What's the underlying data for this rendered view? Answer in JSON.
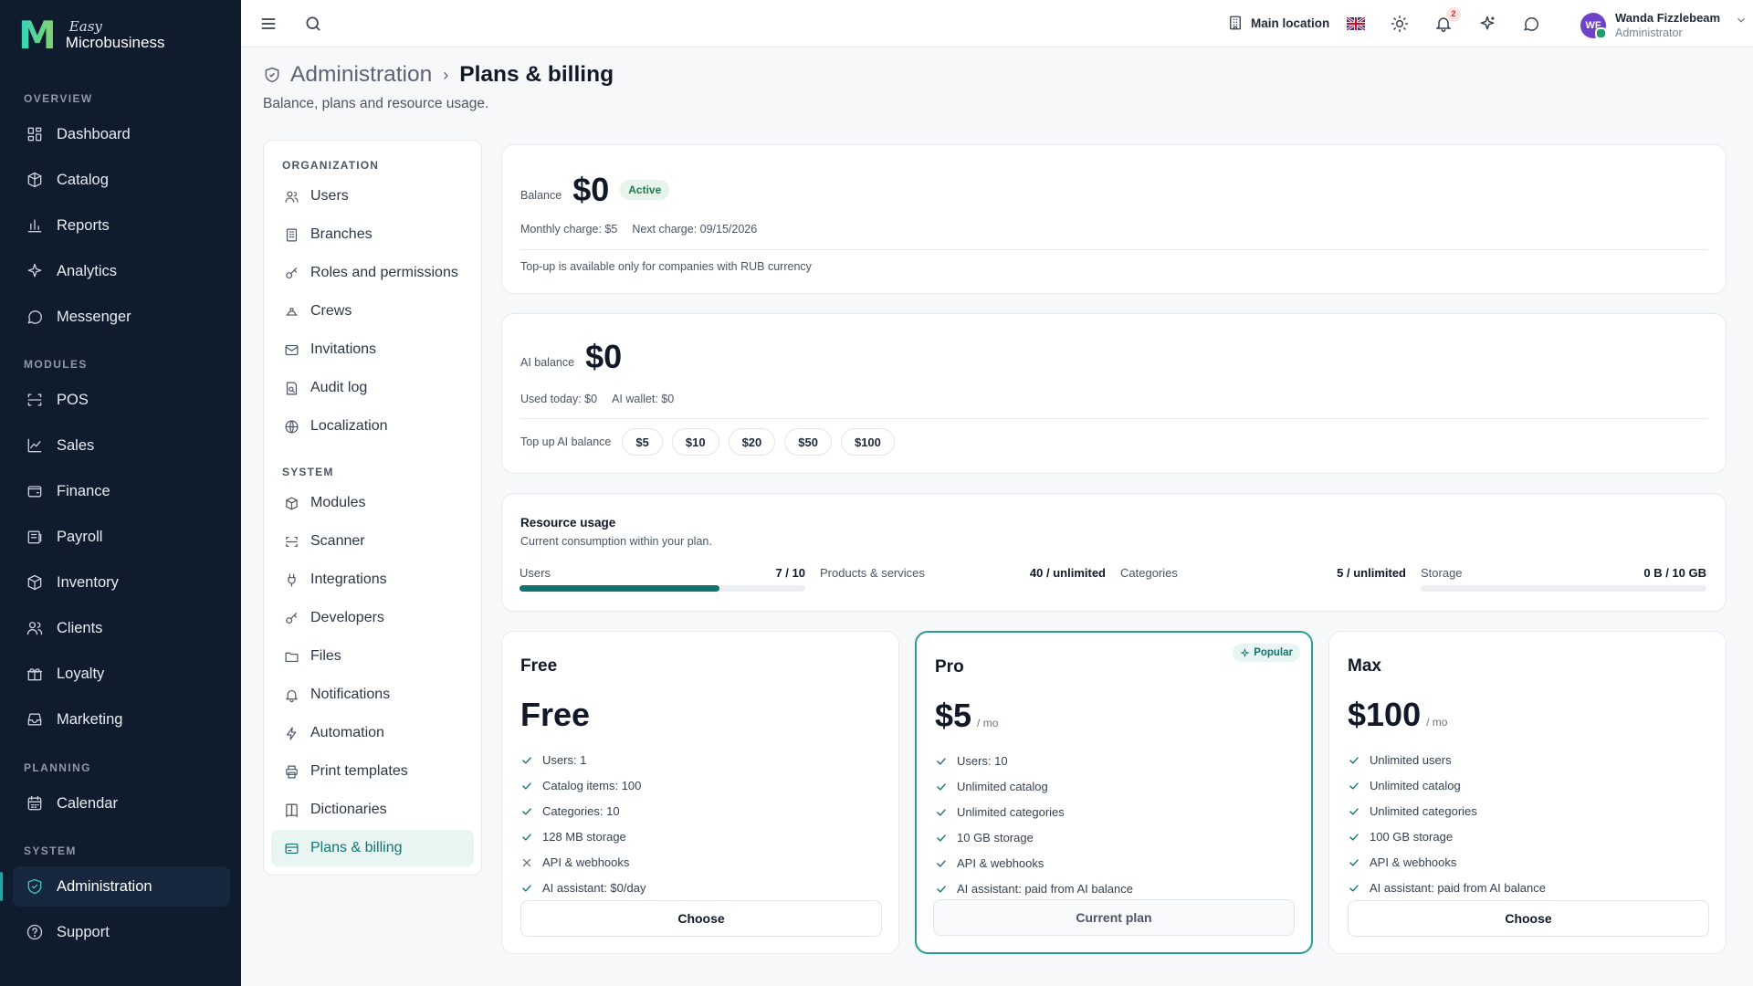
{
  "brand": {
    "mark": "M",
    "line1": "Easy",
    "line2": "Microbusiness"
  },
  "sidebar": {
    "sections": [
      {
        "label": "OVERVIEW",
        "items": [
          {
            "label": "Dashboard",
            "icon": "dashboard-icon"
          },
          {
            "label": "Catalog",
            "icon": "catalog-icon"
          },
          {
            "label": "Reports",
            "icon": "reports-icon"
          },
          {
            "label": "Analytics",
            "icon": "sparkle-icon"
          },
          {
            "label": "Messenger",
            "icon": "chat-icon"
          }
        ]
      },
      {
        "label": "MODULES",
        "items": [
          {
            "label": "POS",
            "icon": "scan-icon"
          },
          {
            "label": "Sales",
            "icon": "line-chart-icon"
          },
          {
            "label": "Finance",
            "icon": "wallet-icon"
          },
          {
            "label": "Payroll",
            "icon": "payroll-icon"
          },
          {
            "label": "Inventory",
            "icon": "box-icon"
          },
          {
            "label": "Clients",
            "icon": "users-icon"
          },
          {
            "label": "Loyalty",
            "icon": "gift-icon"
          },
          {
            "label": "Marketing",
            "icon": "inbox-icon"
          }
        ]
      },
      {
        "label": "PLANNING",
        "items": [
          {
            "label": "Calendar",
            "icon": "calendar-icon"
          }
        ]
      },
      {
        "label": "SYSTEM",
        "items": [
          {
            "label": "Administration",
            "icon": "shield-icon",
            "active": true
          },
          {
            "label": "Support",
            "icon": "help-icon"
          }
        ]
      }
    ]
  },
  "topbar": {
    "location": "Main location",
    "notifications_count": "2",
    "user": {
      "initials": "WF",
      "name": "Wanda Fizzlebeam",
      "role": "Administrator"
    }
  },
  "page": {
    "breadcrumb_parent": "Administration",
    "breadcrumb_sep": "›",
    "title": "Plans & billing",
    "subtitle": "Balance, plans and resource usage."
  },
  "subnav": {
    "sections": [
      {
        "label": "ORGANIZATION",
        "items": [
          {
            "label": "Users",
            "icon": "users-icon"
          },
          {
            "label": "Branches",
            "icon": "building-icon"
          },
          {
            "label": "Roles and permissions",
            "icon": "key-icon"
          },
          {
            "label": "Crews",
            "icon": "crew-icon"
          },
          {
            "label": "Invitations",
            "icon": "mail-icon"
          },
          {
            "label": "Audit log",
            "icon": "audit-icon"
          },
          {
            "label": "Localization",
            "icon": "globe-icon"
          }
        ]
      },
      {
        "label": "SYSTEM",
        "items": [
          {
            "label": "Modules",
            "icon": "box-icon"
          },
          {
            "label": "Scanner",
            "icon": "scan-icon"
          },
          {
            "label": "Integrations",
            "icon": "plug-icon"
          },
          {
            "label": "Developers",
            "icon": "key-icon"
          },
          {
            "label": "Files",
            "icon": "folder-icon"
          },
          {
            "label": "Notifications",
            "icon": "bell-icon"
          },
          {
            "label": "Automation",
            "icon": "bolt-icon"
          },
          {
            "label": "Print templates",
            "icon": "printer-icon"
          },
          {
            "label": "Dictionaries",
            "icon": "book-icon"
          },
          {
            "label": "Plans & billing",
            "icon": "card-icon",
            "active": true
          }
        ]
      }
    ]
  },
  "balance": {
    "label": "Balance",
    "amount": "$0",
    "status": "Active",
    "monthly_charge": "Monthly charge: $5",
    "next_charge": "Next charge: 09/15/2026",
    "note": "Top-up is available only for companies with RUB currency"
  },
  "ai_balance": {
    "label": "AI balance",
    "amount": "$0",
    "used_today": "Used today: $0",
    "wallet": "AI wallet: $0",
    "topup_label": "Top up AI balance",
    "topup_options": [
      "$5",
      "$10",
      "$20",
      "$50",
      "$100"
    ]
  },
  "resources": {
    "title": "Resource usage",
    "subtitle": "Current consumption within your plan.",
    "items": [
      {
        "label": "Users",
        "value": "7 / 10",
        "fraction": 0.7,
        "bar": true
      },
      {
        "label": "Products & services",
        "value": "40 / unlimited",
        "bar": false
      },
      {
        "label": "Categories",
        "value": "5 / unlimited",
        "bar": false
      },
      {
        "label": "Storage",
        "value": "0 B / 10 GB",
        "fraction": 0,
        "bar": true
      }
    ]
  },
  "plans": [
    {
      "name": "Free",
      "price": "Free",
      "unit": "",
      "popular": false,
      "button": "Choose",
      "current": false,
      "features": [
        {
          "t": "Users: 1",
          "ok": true
        },
        {
          "t": "Catalog items: 100",
          "ok": true
        },
        {
          "t": "Categories: 10",
          "ok": true
        },
        {
          "t": "128 MB storage",
          "ok": true
        },
        {
          "t": "API & webhooks",
          "ok": false
        },
        {
          "t": "AI assistant: $0/day",
          "ok": true
        }
      ]
    },
    {
      "name": "Pro",
      "price": "$5",
      "unit": "/ mo",
      "popular": true,
      "popular_label": "Popular",
      "button": "Current plan",
      "current": true,
      "features": [
        {
          "t": "Users: 10",
          "ok": true
        },
        {
          "t": "Unlimited catalog",
          "ok": true
        },
        {
          "t": "Unlimited categories",
          "ok": true
        },
        {
          "t": "10 GB storage",
          "ok": true
        },
        {
          "t": "API & webhooks",
          "ok": true
        },
        {
          "t": "AI assistant: paid from AI balance",
          "ok": true
        }
      ]
    },
    {
      "name": "Max",
      "price": "$100",
      "unit": "/ mo",
      "popular": false,
      "button": "Choose",
      "current": false,
      "features": [
        {
          "t": "Unlimited users",
          "ok": true
        },
        {
          "t": "Unlimited catalog",
          "ok": true
        },
        {
          "t": "Unlimited categories",
          "ok": true
        },
        {
          "t": "100 GB storage",
          "ok": true
        },
        {
          "t": "API & webhooks",
          "ok": true
        },
        {
          "t": "AI assistant: paid from AI balance",
          "ok": true
        }
      ]
    }
  ],
  "colors": {
    "accent": "#15736d",
    "sidebar_bg": "#0f1c2e",
    "active_badge": "#e6f4ec"
  }
}
